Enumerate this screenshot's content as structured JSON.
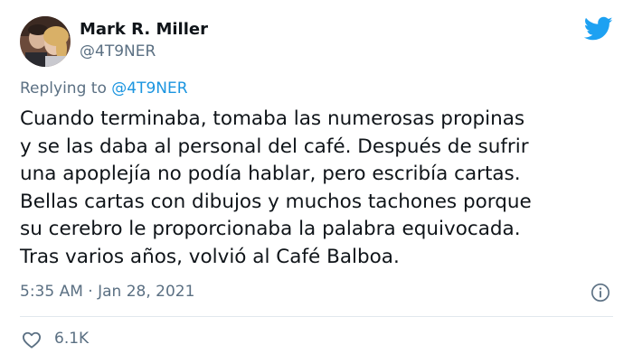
{
  "author": {
    "display_name": "Mark R. Miller",
    "handle": "@4T9NER"
  },
  "reply": {
    "prefix": "Replying to",
    "mention": "@4T9NER"
  },
  "tweet": {
    "lines": [
      "Cuando terminaba, tomaba las numerosas propinas",
      "y se las daba al personal del café. Después de sufrir",
      "una apoplejía no podía hablar, pero escribía cartas.",
      "Bellas cartas con dibujos y muchos tachones porque",
      "su cerebro le proporcionaba la palabra equivocada.",
      "Tras varios años, volvió al Café Balboa."
    ],
    "timestamp": "5:35 AM · Jan 28, 2021"
  },
  "actions": {
    "like_count": "6.1K"
  },
  "icons": {
    "brand": "twitter-bird-icon",
    "info": "info-icon",
    "like": "heart-icon"
  },
  "colors": {
    "brand_blue": "#1da1f2",
    "mention_blue": "#1b95e0",
    "secondary_text": "#5b7083",
    "primary_text": "#0f1419",
    "divider": "#e1e8ed"
  }
}
